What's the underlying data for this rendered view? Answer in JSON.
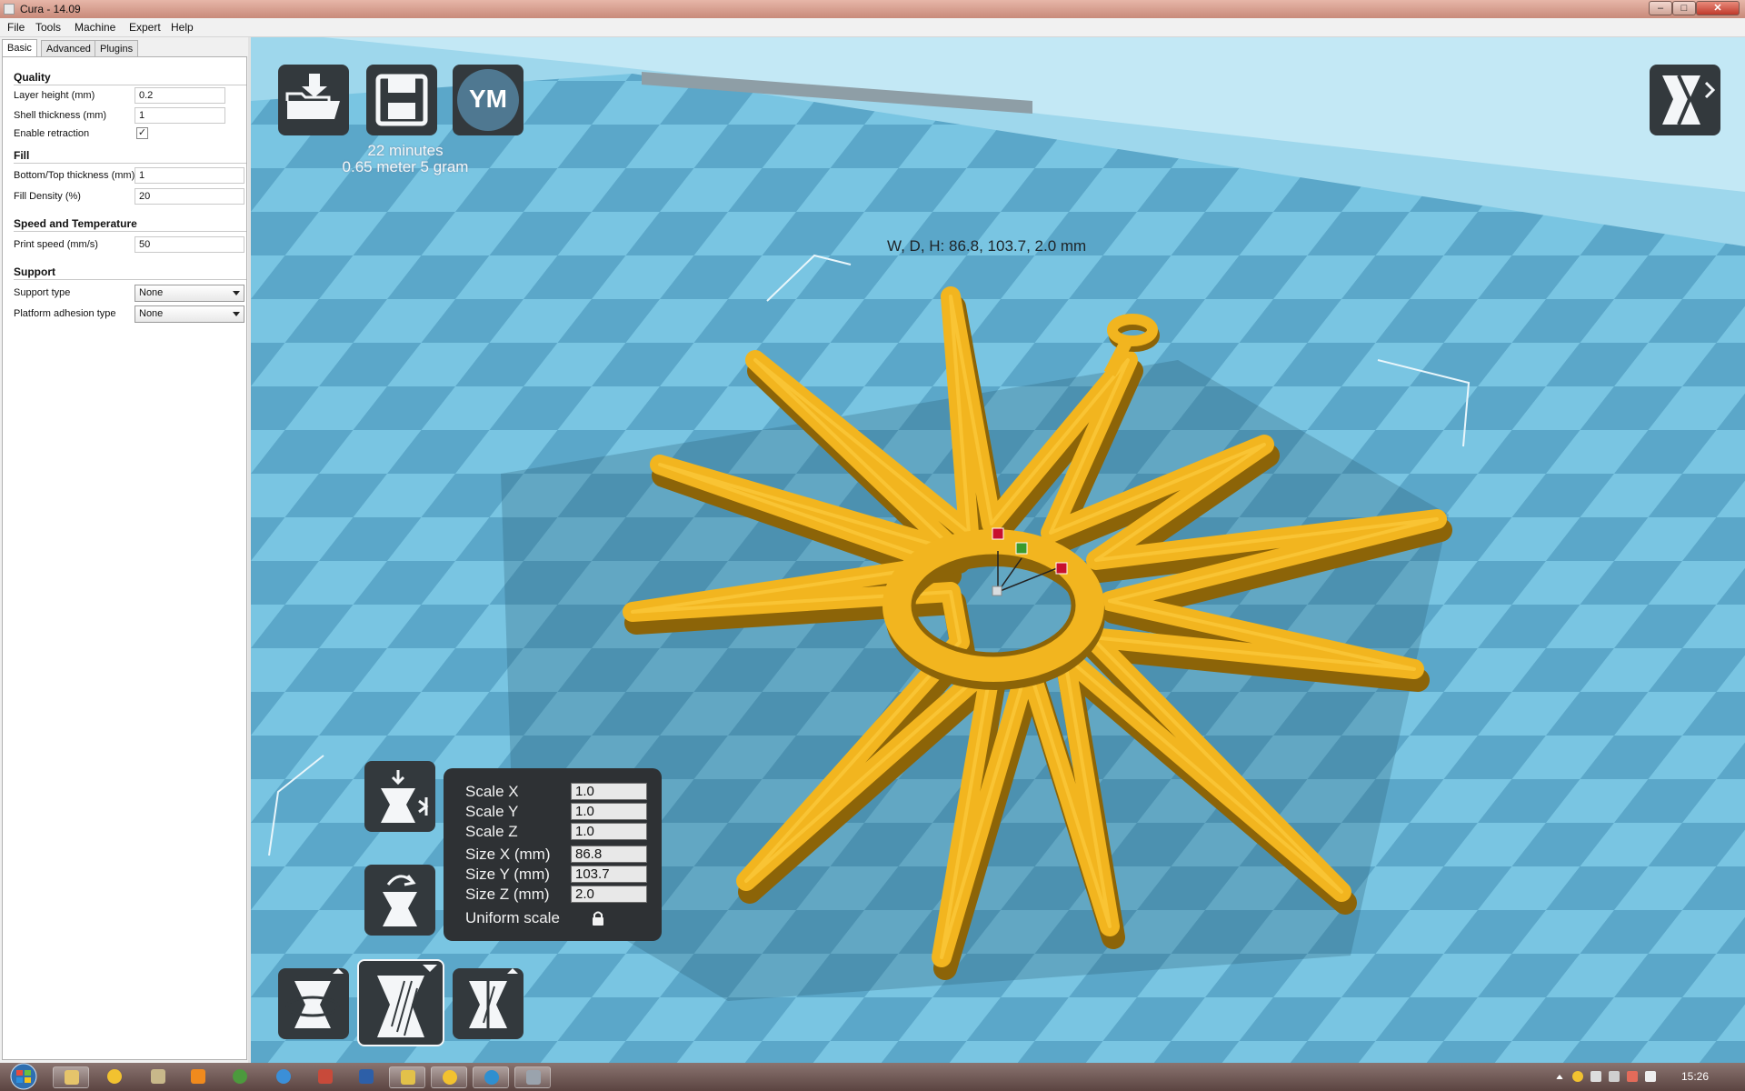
{
  "window": {
    "title": "Cura - 14.09"
  },
  "menu": [
    "File",
    "Tools",
    "Machine",
    "Expert",
    "Help"
  ],
  "tabs": [
    "Basic",
    "Advanced",
    "Plugins"
  ],
  "settings": {
    "quality": {
      "title": "Quality",
      "layer_height_label": "Layer height (mm)",
      "layer_height": "0.2",
      "shell_thickness_label": "Shell thickness (mm)",
      "shell_thickness": "1",
      "retraction_label": "Enable retraction",
      "retraction_checked": "✓"
    },
    "fill": {
      "title": "Fill",
      "bottom_top_label": "Bottom/Top thickness (mm)",
      "bottom_top": "1",
      "density_label": "Fill Density (%)",
      "density": "20"
    },
    "speed": {
      "title": "Speed and Temperature",
      "print_speed_label": "Print speed (mm/s)",
      "print_speed": "50"
    },
    "support": {
      "title": "Support",
      "support_type_label": "Support type",
      "support_type": "None",
      "adhesion_label": "Platform adhesion type",
      "adhesion": "None"
    }
  },
  "viewport": {
    "print_time": "22 minutes",
    "print_material": "0.65 meter 5 gram",
    "ym_label": "YM",
    "dimensions": "W, D, H: 86.8, 103.7, 2.0 mm"
  },
  "scale_panel": {
    "scale_x_label": "Scale X",
    "scale_x": "1.0",
    "scale_y_label": "Scale Y",
    "scale_y": "1.0",
    "scale_z_label": "Scale Z",
    "scale_z": "1.0",
    "size_x_label": "Size X (mm)",
    "size_x": "86.8",
    "size_y_label": "Size Y (mm)",
    "size_y": "103.7",
    "size_z_label": "Size Z (mm)",
    "size_z": "2.0",
    "uniform_label": "Uniform scale"
  },
  "taskbar": {
    "clock": "15:26"
  },
  "colors": {
    "model": "#f2b51f",
    "model_dark": "#8c6408",
    "bed_light": "#79c5e2",
    "bed_dark": "#5ba7c9",
    "toolbar_button": "#33393d"
  }
}
